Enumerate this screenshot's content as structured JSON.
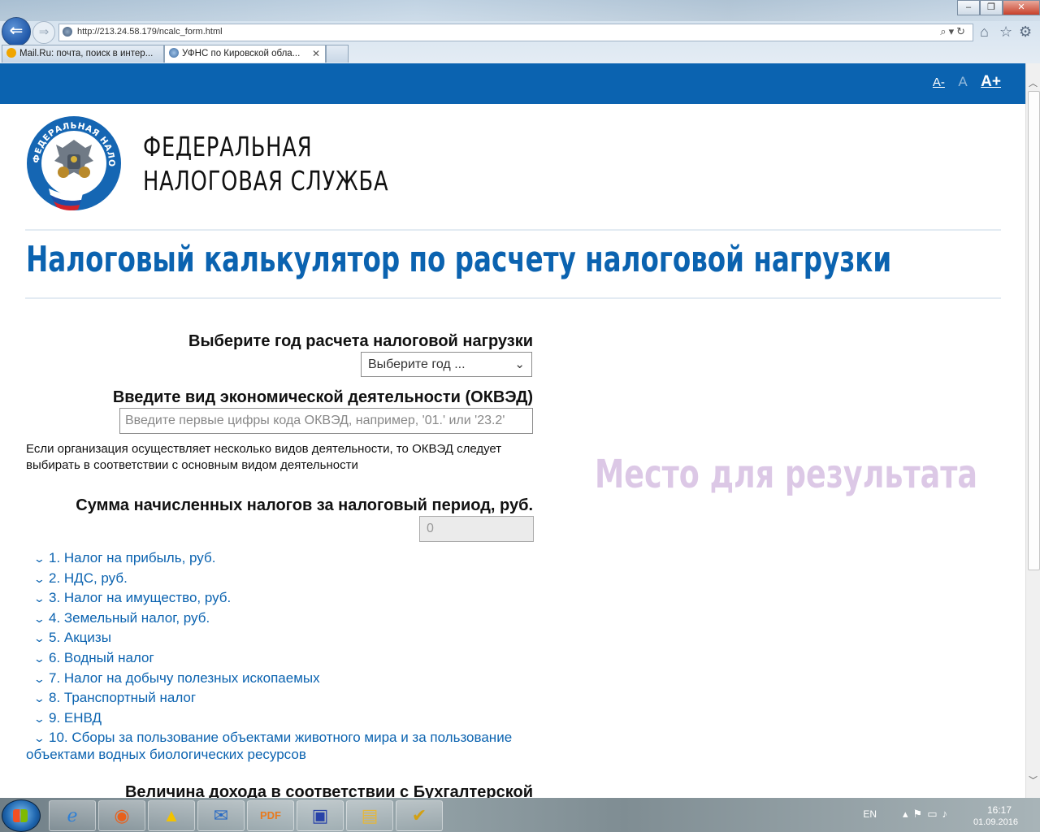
{
  "browser": {
    "address": "http://213.24.58.179/ncalc_form.html",
    "tabs": [
      {
        "title": "Mail.Ru: почта, поиск в интер..."
      },
      {
        "title": "УФНС по Кировской обла...",
        "close": "✕"
      }
    ]
  },
  "header": {
    "font_size_controls": [
      "А-",
      "А",
      "А+"
    ],
    "agency_name_line1": "ФЕДЕРАЛЬНАЯ",
    "agency_name_line2": "НАЛОГОВАЯ СЛУЖБА",
    "emblem_text": "ФЕДЕРАЛЬНАЯ НАЛОГОВАЯ СЛУЖБА"
  },
  "page_title": "Налоговый калькулятор по расчету налоговой нагрузки",
  "form": {
    "year_label": "Выберите год расчета налоговой нагрузки",
    "year_select_value": "Выберите год ...",
    "okved_label": "Введите вид экономической деятельности (ОКВЭД)",
    "okved_placeholder": "Введите первые цифры кода ОКВЭД, например, '01.' или '23.2'",
    "okved_note": "Если организация осуществляет несколько видов деятельности, то ОКВЭД следует выбирать в соответствии с основным видом деятельности",
    "taxes_label": "Сумма начисленных налогов за налоговый период, руб.",
    "taxes_total": "0",
    "tax_items": [
      "1. Налог на прибыль, руб.",
      "2. НДС, руб.",
      "3. Налог на имущество, руб.",
      "4. Земельный налог, руб.",
      "5. Акцизы",
      "6. Водный налог",
      "7. Налог на добычу полезных ископаемых",
      "8. Транспортный налог",
      "9. ЕНВД",
      "10. Сборы за пользование объектами животного мира и за пользование объектами водных биологических ресурсов"
    ],
    "income_label": "Величина дохода в соответствии с Бухгалтерской"
  },
  "result_placeholder": "Место для результата",
  "colors": {
    "brand_blue": "#0b63b0",
    "placeholder_lilac": "#dcc8e6"
  },
  "taskbar": {
    "apps": [
      "internet-explorer-icon",
      "firefox-icon",
      "drive-icon",
      "thunderbird-icon",
      "pdf-icon",
      "save-disk-icon",
      "explorer-folder-icon",
      "checklist-icon"
    ],
    "lang": "EN",
    "time": "16:17",
    "date": "01.09.2016"
  }
}
